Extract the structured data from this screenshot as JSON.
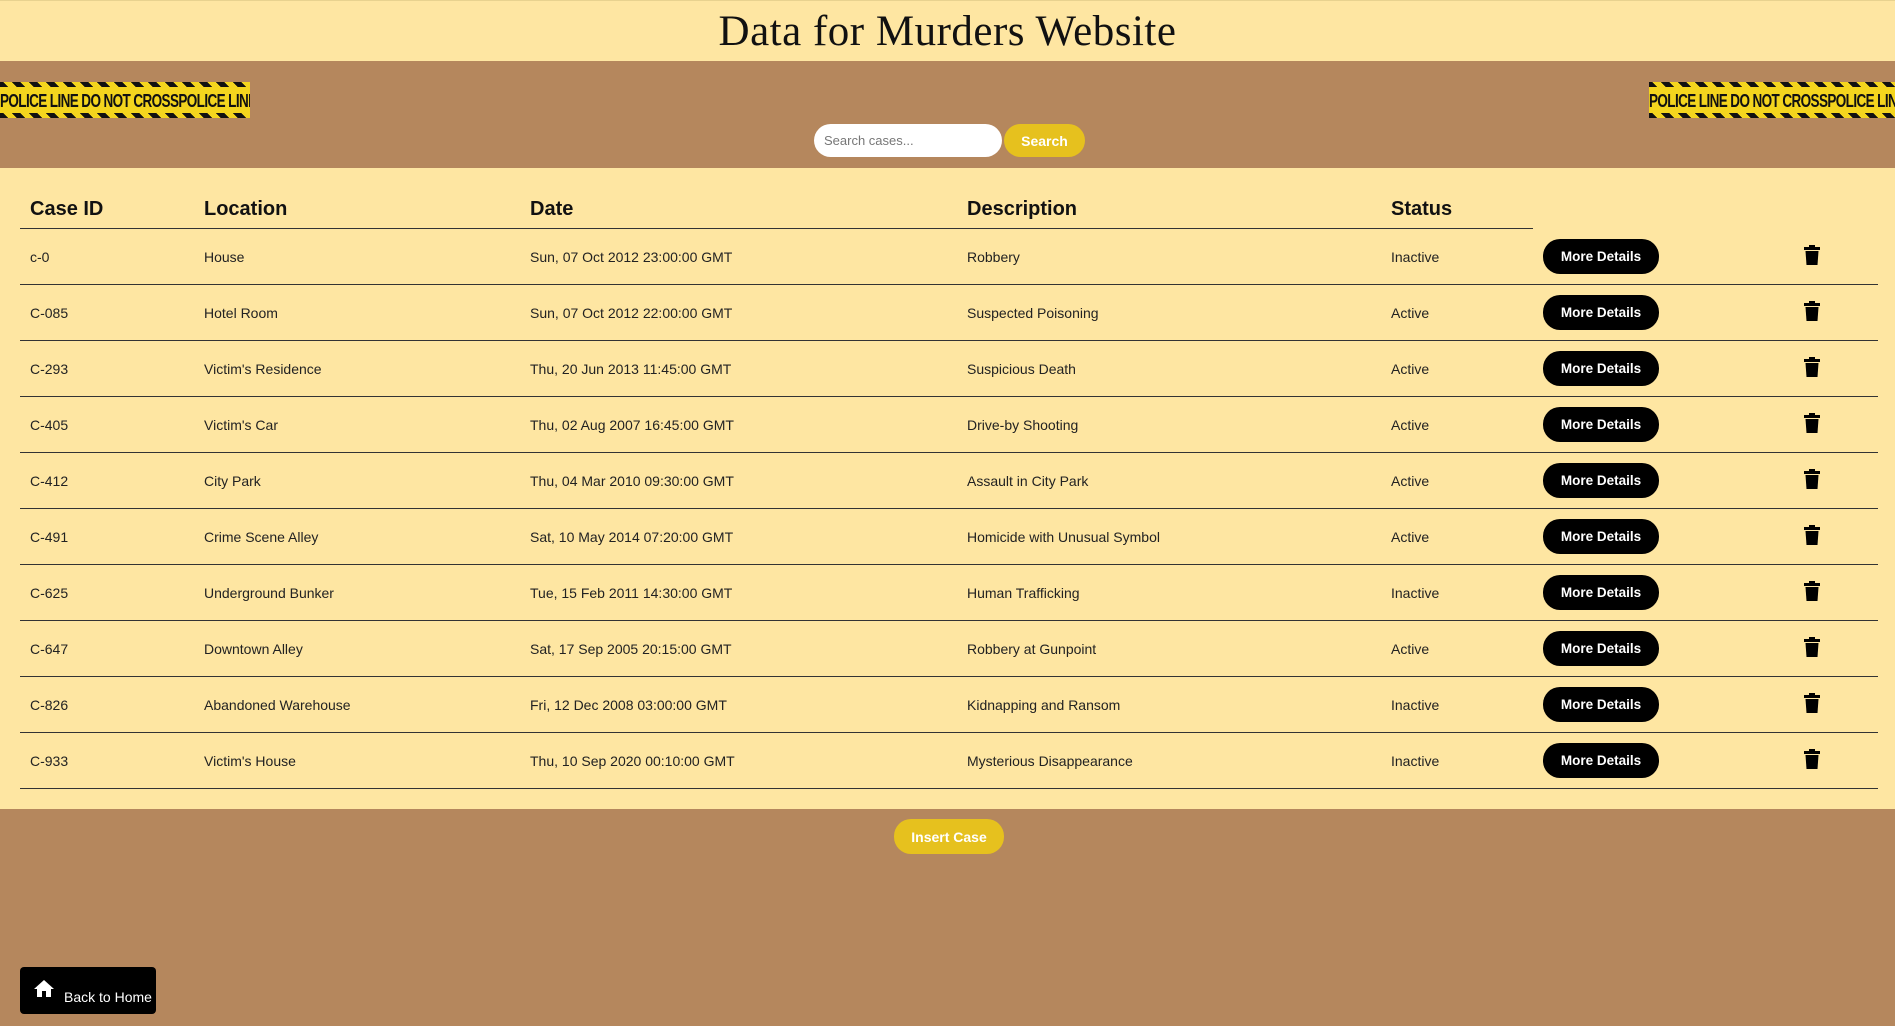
{
  "header": {
    "title": "Data for Murders Website"
  },
  "tape": {
    "text": "POLICE LINE DO NOT CROSS"
  },
  "search": {
    "placeholder": "Search cases...",
    "button_label": "Search"
  },
  "table": {
    "columns": [
      "Case ID",
      "Location",
      "Date",
      "Description",
      "Status"
    ],
    "rows": [
      {
        "id": "c-0",
        "location": "House",
        "date": "Sun, 07 Oct 2012 23:00:00 GMT",
        "description": "Robbery",
        "status": "Inactive"
      },
      {
        "id": "C-085",
        "location": "Hotel Room",
        "date": "Sun, 07 Oct 2012 22:00:00 GMT",
        "description": "Suspected Poisoning",
        "status": "Active"
      },
      {
        "id": "C-293",
        "location": "Victim's Residence",
        "date": "Thu, 20 Jun 2013 11:45:00 GMT",
        "description": "Suspicious Death",
        "status": "Active"
      },
      {
        "id": "C-405",
        "location": "Victim's Car",
        "date": "Thu, 02 Aug 2007 16:45:00 GMT",
        "description": "Drive-by Shooting",
        "status": "Active"
      },
      {
        "id": "C-412",
        "location": "City Park",
        "date": "Thu, 04 Mar 2010 09:30:00 GMT",
        "description": "Assault in City Park",
        "status": "Active"
      },
      {
        "id": "C-491",
        "location": "Crime Scene Alley",
        "date": "Sat, 10 May 2014 07:20:00 GMT",
        "description": "Homicide with Unusual Symbol",
        "status": "Active"
      },
      {
        "id": "C-625",
        "location": "Underground Bunker",
        "date": "Tue, 15 Feb 2011 14:30:00 GMT",
        "description": "Human Trafficking",
        "status": "Inactive"
      },
      {
        "id": "C-647",
        "location": "Downtown Alley",
        "date": "Sat, 17 Sep 2005 20:15:00 GMT",
        "description": "Robbery at Gunpoint",
        "status": "Active"
      },
      {
        "id": "C-826",
        "location": "Abandoned Warehouse",
        "date": "Fri, 12 Dec 2008 03:00:00 GMT",
        "description": "Kidnapping and Ransom",
        "status": "Inactive"
      },
      {
        "id": "C-933",
        "location": "Victim's House",
        "date": "Thu, 10 Sep 2020 00:10:00 GMT",
        "description": "Mysterious Disappearance",
        "status": "Inactive"
      }
    ],
    "details_label": "More Details",
    "delete_icon": "trash-icon"
  },
  "actions": {
    "insert_label": "Insert Case"
  },
  "footer": {
    "back_label": "Back to Home",
    "back_icon": "home-icon"
  },
  "colors": {
    "background": "#b5875d",
    "panel": "#fee6a2",
    "accent_yellow": "#e6c11e",
    "tape_yellow": "#f4d51e",
    "button_black": "#000000"
  }
}
